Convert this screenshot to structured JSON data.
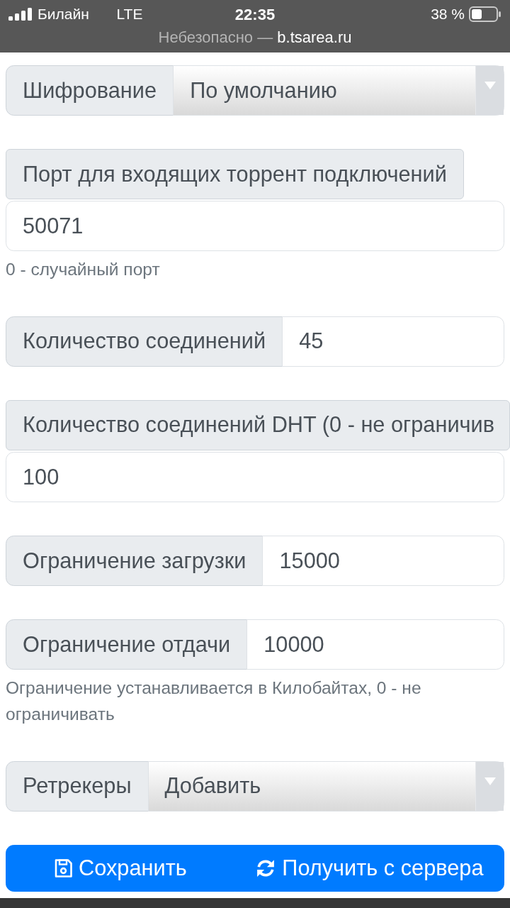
{
  "status_bar": {
    "carrier": "Билайн",
    "network": "LTE",
    "time": "22:35",
    "battery": "38 %"
  },
  "address_bar": {
    "security": "Небезопасно —",
    "host": "b.tsarea.ru"
  },
  "fields": [
    {
      "kind": "select",
      "label": "Шифрование",
      "value": "По умолчанию"
    },
    {
      "kind": "stacked",
      "label": "Порт для входящих торрент подключений",
      "value": "50071",
      "help": "0 - случайный порт"
    },
    {
      "kind": "inline",
      "label": "Количество соединений",
      "value": "45"
    },
    {
      "kind": "stacked",
      "label": "Количество соединений DHT (0 - не ограничив",
      "value": "100"
    },
    {
      "kind": "inline",
      "label": "Ограничение загрузки",
      "value": "15000"
    },
    {
      "kind": "inline",
      "label": "Ограничение отдачи",
      "value": "10000",
      "help": "Ограничение устанавливается в Килобайтах, 0 - не ограничивать"
    },
    {
      "kind": "select",
      "label": "Ретрекеры",
      "value": "Добавить"
    }
  ],
  "actions": [
    {
      "kind": "save",
      "label": "Сохранить"
    },
    {
      "kind": "refresh",
      "label": "Получить с сервера"
    }
  ]
}
